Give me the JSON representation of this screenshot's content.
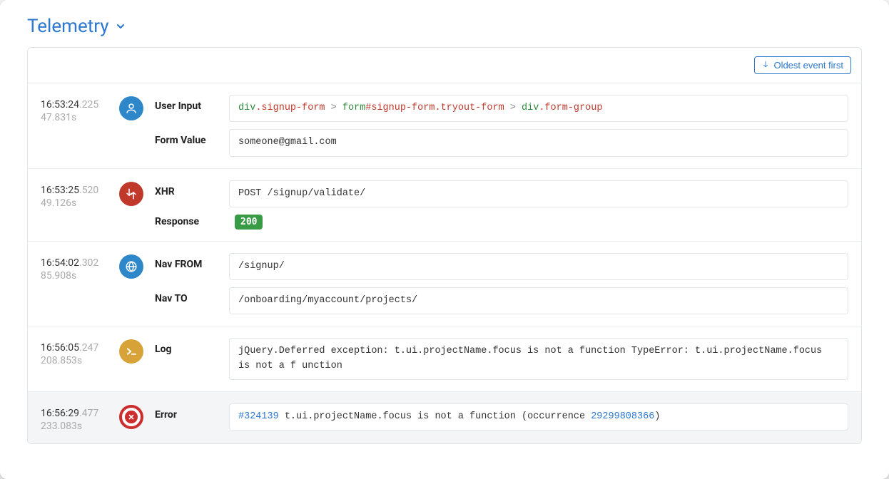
{
  "title": "Telemetry",
  "sort_button": "Oldest event first",
  "labels": {
    "user_input": "User Input",
    "form_value": "Form Value",
    "xhr": "XHR",
    "response": "Response",
    "nav_from": "Nav FROM",
    "nav_to": "Nav TO",
    "log": "Log",
    "error": "Error"
  },
  "events": [
    {
      "time": "16:53:24",
      "ms": ".225",
      "elapsed": "47.831s",
      "selector": {
        "p1a": "div",
        "p1b": ".signup-form",
        "p2a": "form",
        "p2b": "#signup-form",
        "p2c": ".tryout-form",
        "p3a": "div",
        "p3b": ".form-group"
      },
      "form_value": "someone@gmail.com"
    },
    {
      "time": "16:53:25",
      "ms": ".520",
      "elapsed": "49.126s",
      "request": "POST /signup/validate/",
      "status": "200"
    },
    {
      "time": "16:54:02",
      "ms": ".302",
      "elapsed": "85.908s",
      "nav_from": "/signup/",
      "nav_to": "/onboarding/myaccount/projects/"
    },
    {
      "time": "16:56:05",
      "ms": ".247",
      "elapsed": "208.853s",
      "log": "jQuery.Deferred exception: t.ui.projectName.focus is not a function TypeError: t.ui.projectName.focus is not a f unction"
    },
    {
      "time": "16:56:29",
      "ms": ".477",
      "elapsed": "233.083s",
      "error": {
        "id": "#324139",
        "mid": " t.ui.projectName.focus is not a function (occurrence ",
        "occ": "29299808366",
        "end": ")"
      }
    }
  ]
}
